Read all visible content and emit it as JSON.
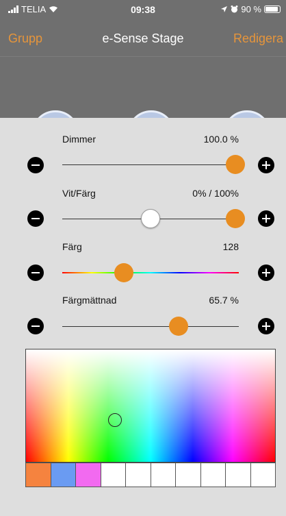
{
  "status": {
    "carrier": "TELIA",
    "time": "09:38",
    "battery": "90 %",
    "icons": [
      "signal-icon",
      "wifi-icon",
      "location-icon",
      "alarm-icon",
      "battery-icon"
    ]
  },
  "nav": {
    "left_label": "Grupp",
    "title": "e-Sense Stage",
    "right_label": "Redigera"
  },
  "sliders": [
    {
      "label": "Dimmer",
      "value": "100.0 %",
      "position": 1.0
    },
    {
      "label": "Vit/Färg",
      "value": "0% / 100%",
      "position_a": 0.5,
      "position_b": 1.0
    },
    {
      "label": "Färg",
      "value": "128",
      "position": 0.35
    },
    {
      "label": "Färgmättnad",
      "value": "65.7 %",
      "position": 0.657
    }
  ],
  "swatches": [
    "#f5833f",
    "#6a9bf2",
    "#f26af0",
    "#ffffff",
    "#ffffff",
    "#ffffff",
    "#ffffff",
    "#ffffff",
    "#ffffff",
    "#ffffff"
  ],
  "colors": {
    "accent": "#e88d21",
    "nav_bg": "#6f6f6f",
    "sheet_bg": "#dedede"
  }
}
